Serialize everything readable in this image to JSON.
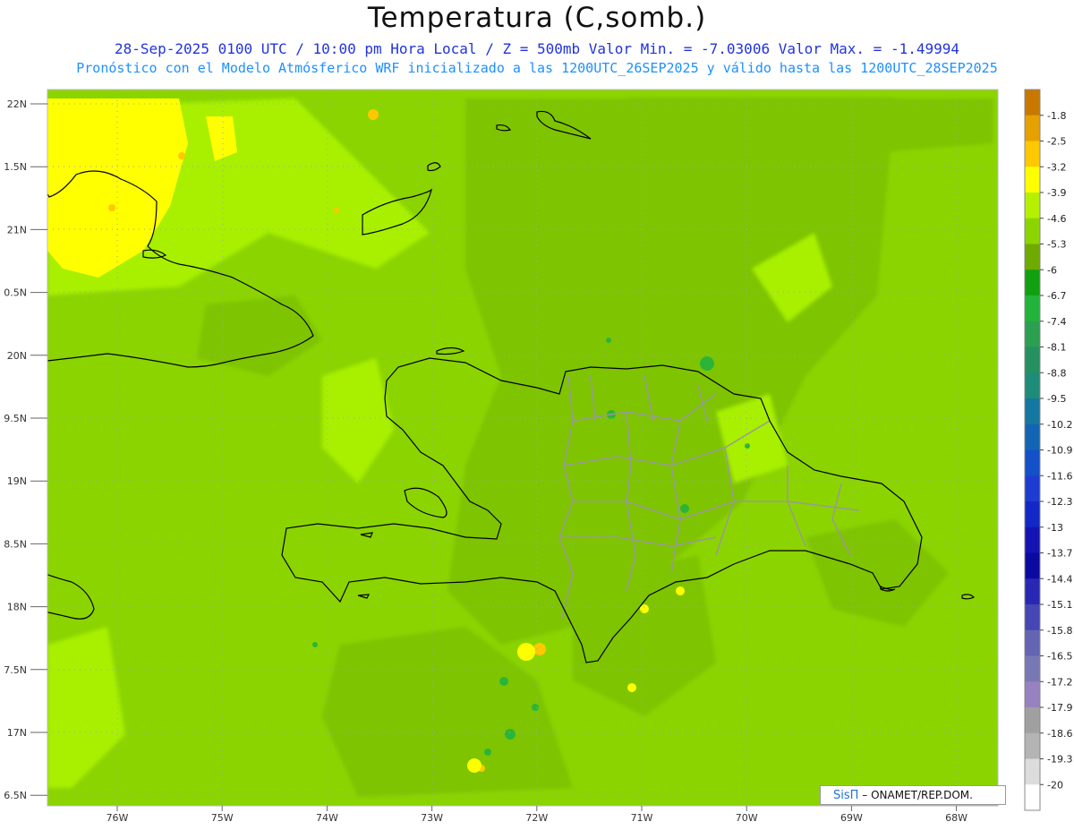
{
  "header": {
    "title": "Temperatura (C,somb.)",
    "line1": "28-Sep-2025 0100 UTC / 10:00 pm Hora Local / Z = 500mb Valor Min. = -7.03006 Valor Max. = -1.49994",
    "line2": "Pronóstico con el Modelo Atmósferico WRF inicializado a las 1200UTC_26SEP2025 y válido hasta las 1200UTC_28SEP2025"
  },
  "map": {
    "lat_labels": [
      "22N",
      "1.5N",
      "21N",
      "0.5N",
      "20N",
      "9.5N",
      "19N",
      "8.5N",
      "18N",
      "7.5N",
      "17N",
      "6.5N"
    ],
    "lon_labels": [
      "76W",
      "75W",
      "74W",
      "73W",
      "72W",
      "71W",
      "70W",
      "69W",
      "68W"
    ],
    "colors": {
      "base": "#8bd400",
      "darker": "#7ec400",
      "lighter": "#a8f000",
      "warm": "#ffff00",
      "orange": "#ffc800",
      "green": "#2cb43a",
      "coast": "#000000",
      "border": "#999999"
    }
  },
  "colorbar": {
    "labels": [
      "-1.8",
      "-2.5",
      "-3.2",
      "-3.9",
      "-4.6",
      "-5.3",
      "-6",
      "-6.7",
      "-7.4",
      "-8.1",
      "-8.8",
      "-9.5",
      "-10.2",
      "-10.9",
      "-11.6",
      "-12.3",
      "-13",
      "-13.7",
      "-14.4",
      "-15.1",
      "-15.8",
      "-16.5",
      "-17.2",
      "-17.9",
      "-18.6",
      "-19.3",
      "-20"
    ],
    "colors": [
      "#c87800",
      "#e6a000",
      "#ffc800",
      "#ffff00",
      "#b4f000",
      "#8cd400",
      "#6eaa00",
      "#10a010",
      "#22b43a",
      "#2aa050",
      "#259060",
      "#1e8c78",
      "#1478a0",
      "#1464b4",
      "#1450c8",
      "#1e3cd2",
      "#1428c8",
      "#1414b4",
      "#0a0aa0",
      "#2828b4",
      "#4646b4",
      "#6464b4",
      "#7878b4",
      "#9682be",
      "#a0a0a0",
      "#b4b4b4",
      "#dcdcdc",
      "#ffffff"
    ]
  },
  "credit": {
    "brand": "SisΠ",
    "text": "– ONAMET/REP.DOM."
  }
}
